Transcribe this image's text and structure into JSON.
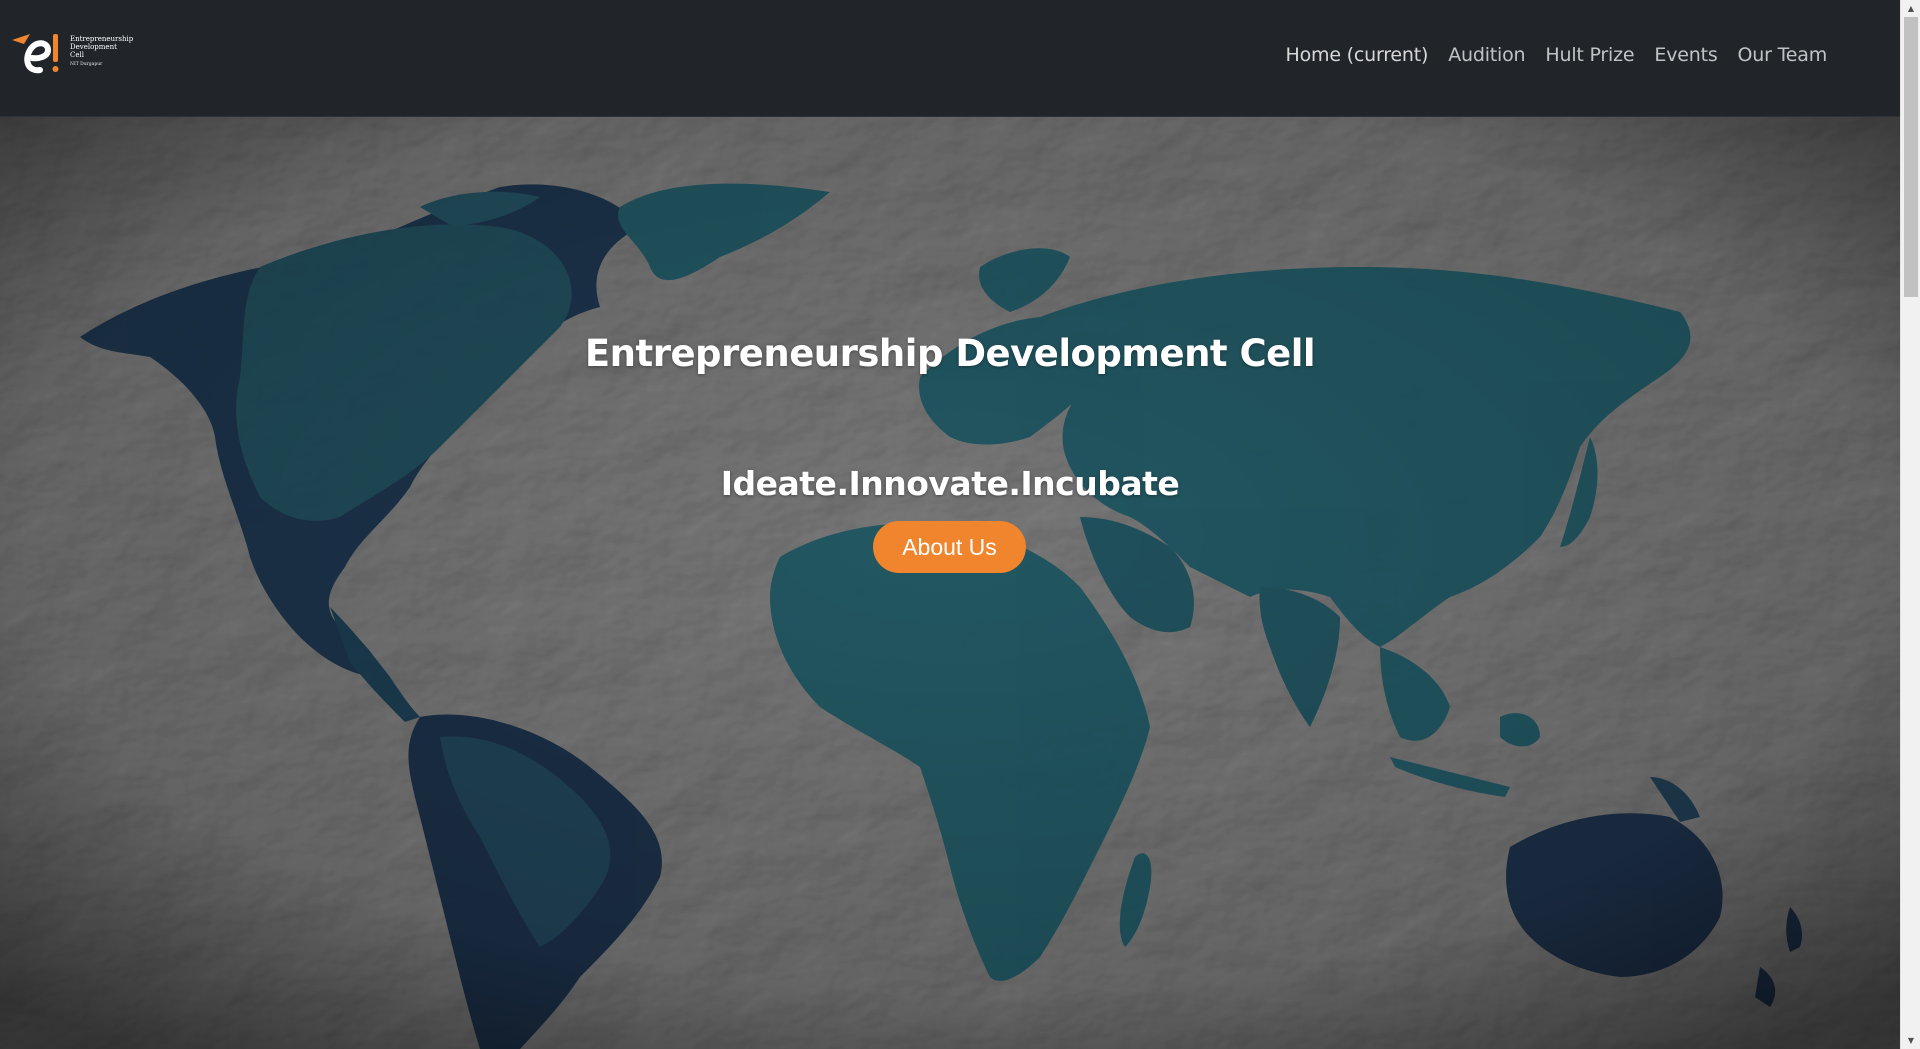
{
  "brand": {
    "lines": [
      "Entrepreneurship",
      "Development",
      "Cell"
    ],
    "sub": "NIT Durgapur",
    "logo_icon": "e-cell-logo-icon"
  },
  "nav": {
    "items": [
      {
        "label": "Home (current)"
      },
      {
        "label": "Audition"
      },
      {
        "label": "Hult Prize"
      },
      {
        "label": "Events"
      },
      {
        "label": "Our Team"
      }
    ]
  },
  "hero": {
    "title": "Entrepreneurship Development Cell",
    "tagline": "Ideate.Innovate.Incubate",
    "button_label": "About Us",
    "background": "world-map-crumpled-paper"
  },
  "colors": {
    "navbar": "#212529",
    "accent": "#f0852d",
    "map_land": "#1d5058",
    "map_land_dark": "#172a3f",
    "paper": "#6a6a6a"
  },
  "scrollbar": {
    "up_icon": "scroll-up-arrow-icon",
    "down_icon": "scroll-down-arrow-icon"
  }
}
